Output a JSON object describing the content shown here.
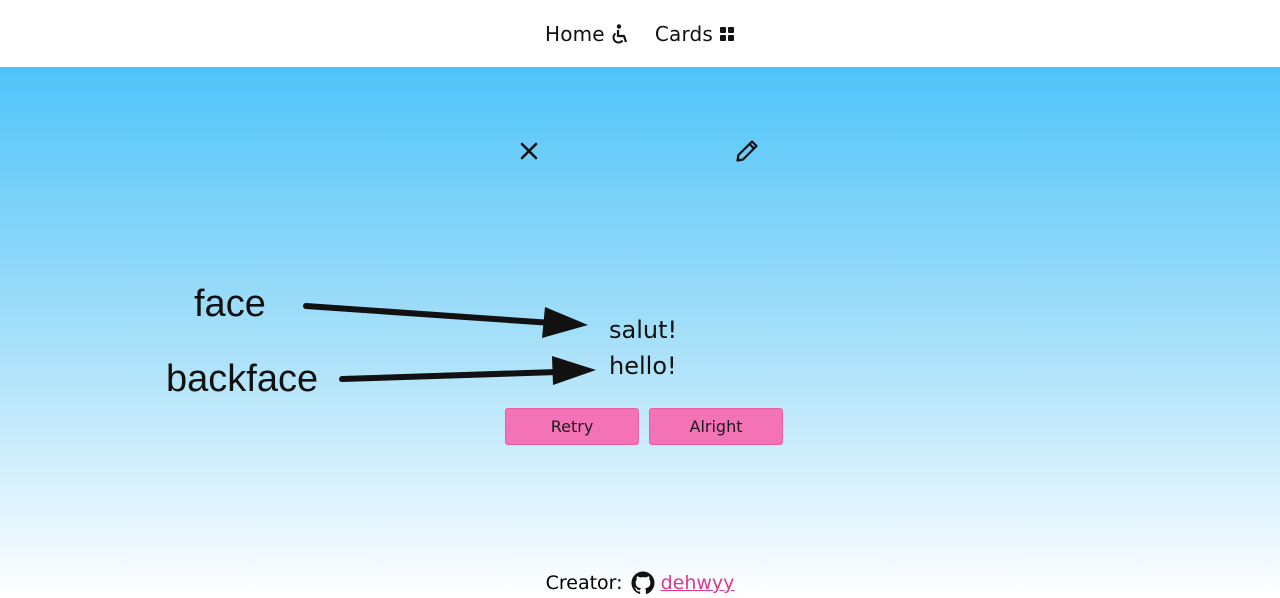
{
  "nav": {
    "home_label": "Home",
    "home_icon": "wheelchair-icon",
    "cards_label": "Cards",
    "cards_icon": "grid-icon"
  },
  "card": {
    "close_icon": "close-icon",
    "edit_icon": "pencil-icon",
    "face": "salut!",
    "backface": "hello!"
  },
  "annotations": {
    "face_label": "face",
    "backface_label": "backface"
  },
  "buttons": {
    "retry_label": "Retry",
    "alright_label": "Alright"
  },
  "footer": {
    "creator_label": "Creator:",
    "github_icon": "github-icon",
    "username": " dehwyy"
  },
  "colors": {
    "button_bg": "#f472b6",
    "link": "#e0378f",
    "gradient_top": "#4fc4f9",
    "gradient_bottom": "#ffffff"
  }
}
